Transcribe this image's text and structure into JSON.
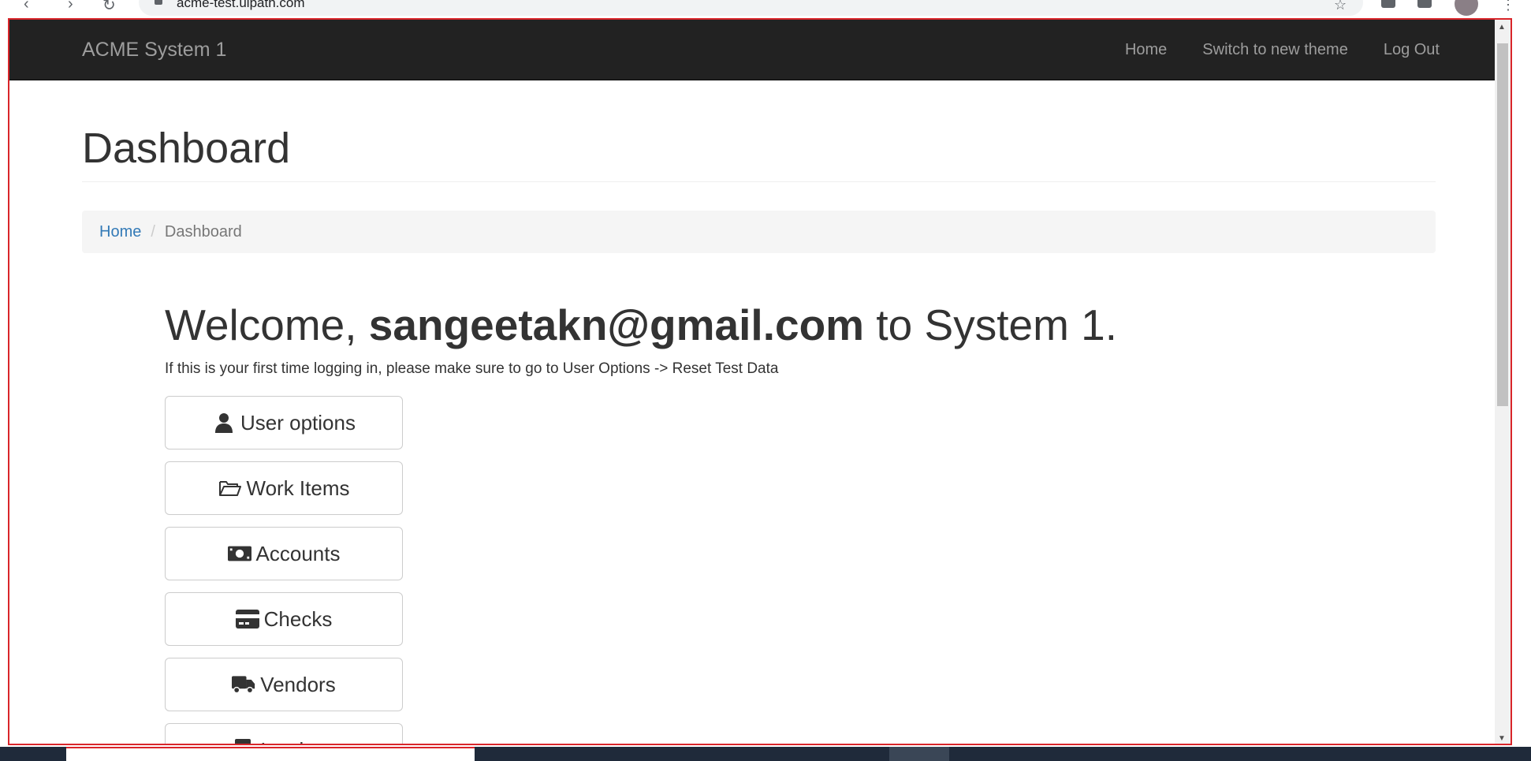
{
  "browser": {
    "url": "acme-test.uipath.com"
  },
  "navbar": {
    "brand": "ACME System 1",
    "links": [
      "Home",
      "Switch to new theme",
      "Log Out"
    ]
  },
  "page": {
    "title": "Dashboard"
  },
  "breadcrumb": {
    "home": "Home",
    "separator": "/",
    "current": "Dashboard"
  },
  "welcome": {
    "prefix": "Welcome, ",
    "user": "sangeetakn@gmail.com",
    "suffix": " to System 1.",
    "hint": "If this is your first time logging in, please make sure to go to User Options -> Reset Test Data"
  },
  "menu": [
    {
      "label": "User options",
      "icon": "user-icon"
    },
    {
      "label": "Work Items",
      "icon": "folder-open-icon"
    },
    {
      "label": "Accounts",
      "icon": "money-icon"
    },
    {
      "label": "Checks",
      "icon": "credit-card-icon"
    },
    {
      "label": "Vendors",
      "icon": "truck-icon"
    },
    {
      "label": "Invoices",
      "icon": "invoice-icon"
    }
  ],
  "colors": {
    "navbar_bg": "#222222",
    "link": "#337ab7",
    "viewport_border": "#d9252a"
  }
}
